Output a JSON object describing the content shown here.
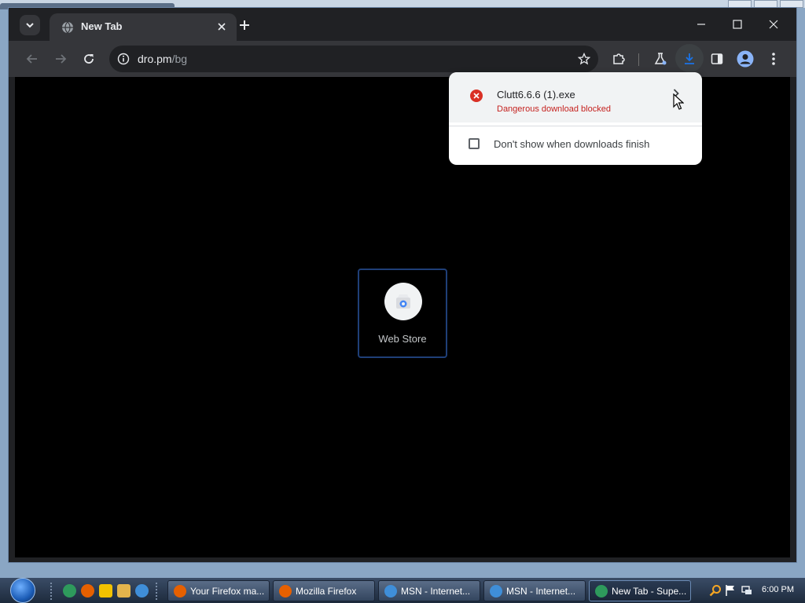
{
  "browser": {
    "tab": {
      "title": "New Tab"
    },
    "address_bar": {
      "domain": "dro.pm",
      "path": "/bg"
    }
  },
  "new_tab_page": {
    "shortcuts": [
      {
        "label": "Web Store"
      }
    ]
  },
  "download_bubble": {
    "filename": "Clutt6.6.6 (1).exe",
    "status": "Dangerous download blocked",
    "checkbox_label": "Don't show when downloads finish",
    "checkbox_checked": false,
    "status_color": "#c5221f"
  },
  "taskbar": {
    "tasks": [
      {
        "label": "Your Firefox ma...",
        "icon": "firefox-icon"
      },
      {
        "label": "Mozilla Firefox",
        "icon": "firefox-icon"
      },
      {
        "label": "MSN - Internet...",
        "icon": "ie-icon"
      },
      {
        "label": "MSN - Internet...",
        "icon": "ie-icon"
      },
      {
        "label": "New Tab - Supe...",
        "icon": "chrome-icon"
      }
    ],
    "clock": "6:00 PM"
  }
}
